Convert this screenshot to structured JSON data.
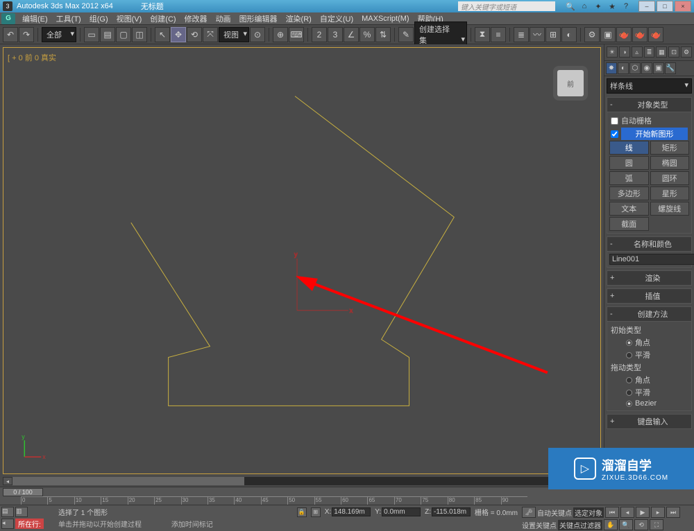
{
  "titlebar": {
    "app_title": "Autodesk 3ds Max 2012 x64",
    "doc_title": "无标题",
    "search_placeholder": "键入关键字或短语",
    "min": "–",
    "max": "□",
    "close": "×"
  },
  "menu": {
    "items": [
      "编辑(E)",
      "工具(T)",
      "组(G)",
      "视图(V)",
      "创建(C)",
      "修改器",
      "动画",
      "图形编辑器",
      "渲染(R)",
      "自定义(U)",
      "MAXScript(M)",
      "帮助(H)"
    ]
  },
  "toolbar": {
    "select_all": "全部",
    "view_label": "视图",
    "create_sel_set": "创建选择集"
  },
  "viewport": {
    "label": "[ + 0 前 0 真实",
    "cube": "前"
  },
  "panel": {
    "category": "样条线",
    "obj_type_title": "对象类型",
    "autogrid": "自动栅格",
    "start_new": "开始新图形",
    "buttons": [
      {
        "l": "线",
        "r": "矩形",
        "active": 0
      },
      {
        "l": "圆",
        "r": "椭圆"
      },
      {
        "l": "弧",
        "r": "圆环"
      },
      {
        "l": "多边形",
        "r": "星形"
      },
      {
        "l": "文本",
        "r": "螺旋线"
      },
      {
        "l": "截面",
        "r": ""
      }
    ],
    "name_color_title": "名称和颜色",
    "object_name": "Line001",
    "render_title": "渲染",
    "interp_title": "插值",
    "create_method_title": "创建方法",
    "init_type": "初始类型",
    "drag_type": "拖动类型",
    "opt_corner": "角点",
    "opt_smooth": "平滑",
    "opt_bezier": "Bezier",
    "kbd_title": "键盘输入"
  },
  "timeline": {
    "pos": "0 / 100",
    "ticks": [
      "0",
      "5",
      "10",
      "15",
      "20",
      "25",
      "30",
      "35",
      "40",
      "45",
      "50",
      "55",
      "60",
      "65",
      "70",
      "75",
      "80",
      "85",
      "90"
    ]
  },
  "status": {
    "current": "所在行:",
    "sel": "选择了 1 个图形",
    "x": "148.169m",
    "y": "0.0mm",
    "z": "-115.018m",
    "grid": "栅格 = 0.0mm",
    "hint": "单击并拖动以开始创建过程",
    "add_time": "添加时间标记",
    "auto_key": "自动关键点",
    "sel_lock": "选定对象",
    "set_key": "设置关键点",
    "key_filter": "关键点过滤器"
  },
  "watermark": {
    "t1": "溜溜自学",
    "t2": "ZIXUE.3D66.COM"
  }
}
